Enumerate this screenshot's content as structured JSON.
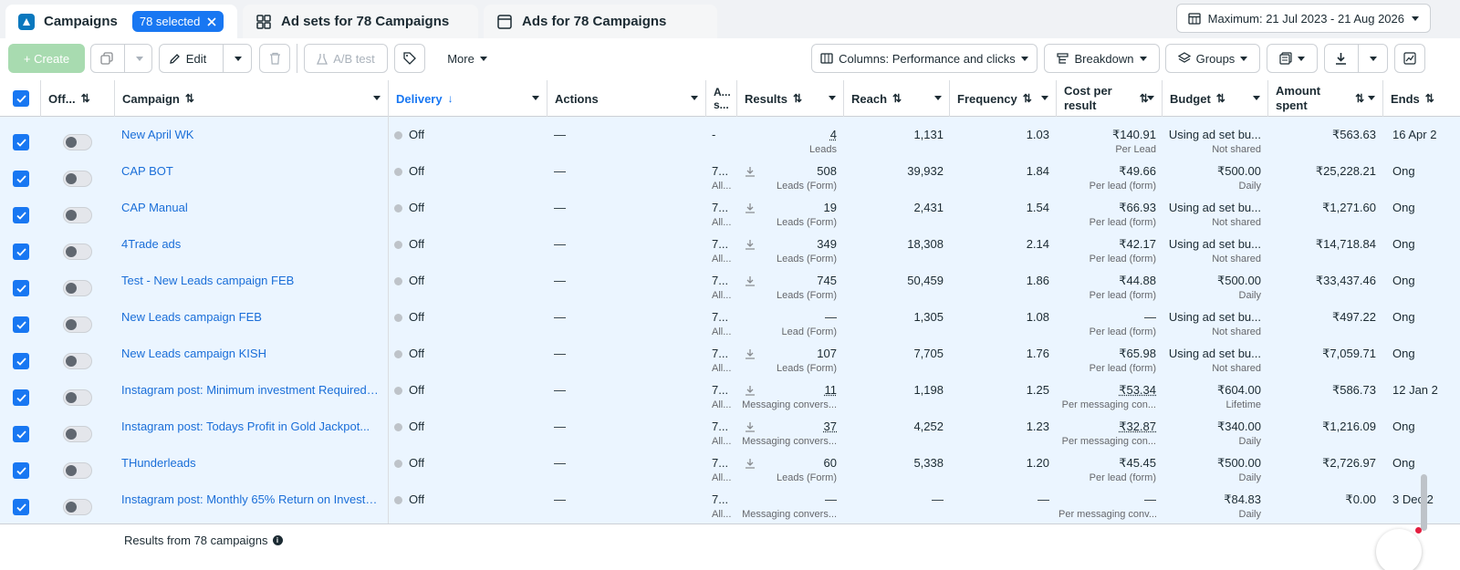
{
  "tabs": {
    "campaigns": "Campaigns",
    "selected_count": "78 selected",
    "ad_sets": "Ad sets for 78 Campaigns",
    "ads": "Ads for 78 Campaigns"
  },
  "date_range": "Maximum: 21 Jul 2023 - 21 Aug 2026",
  "toolbar": {
    "create": "+ Create",
    "edit": "Edit",
    "ab_test": "A/B test",
    "more": "More",
    "columns": "Columns: Performance and clicks",
    "breakdown": "Breakdown",
    "groups": "Groups"
  },
  "headers": {
    "off_on": "Off...",
    "campaign": "Campaign",
    "delivery": "Delivery",
    "actions": "Actions",
    "attribution": "A... s...",
    "results": "Results",
    "reach": "Reach",
    "frequency": "Frequency",
    "cost_per_result_1": "Cost per",
    "cost_per_result_2": "result",
    "budget": "Budget",
    "amount_spent_1": "Amount",
    "amount_spent_2": "spent",
    "ends": "Ends"
  },
  "rows": [
    {
      "name": "New April WK",
      "delivery": "Off",
      "actions": "—",
      "attr": "-",
      "attr_sub": "",
      "results": "4",
      "results_sub": "Leads",
      "reach": "1,131",
      "freq": "1.03",
      "cpr": "₹140.91",
      "cpr_sub": "Per Lead",
      "budget": "Using ad set bu...",
      "budget_sub": "Not shared",
      "spent": "₹563.63",
      "ends": "16 Apr 2"
    },
    {
      "name": "CAP BOT",
      "delivery": "Off",
      "actions": "—",
      "attr": "7...",
      "attr_sub": "All...",
      "results": "508",
      "results_sub": "Leads (Form)",
      "reach": "39,932",
      "freq": "1.84",
      "cpr": "₹49.66",
      "cpr_sub": "Per lead (form)",
      "budget": "₹500.00",
      "budget_sub": "Daily",
      "spent": "₹25,228.21",
      "ends": "Ong"
    },
    {
      "name": "CAP Manual",
      "delivery": "Off",
      "actions": "—",
      "attr": "7...",
      "attr_sub": "All...",
      "results": "19",
      "results_sub": "Leads (Form)",
      "reach": "2,431",
      "freq": "1.54",
      "cpr": "₹66.93",
      "cpr_sub": "Per lead (form)",
      "budget": "Using ad set bu...",
      "budget_sub": "Not shared",
      "spent": "₹1,271.60",
      "ends": "Ong"
    },
    {
      "name": "4Trade ads",
      "delivery": "Off",
      "actions": "—",
      "attr": "7...",
      "attr_sub": "All...",
      "results": "349",
      "results_sub": "Leads (Form)",
      "reach": "18,308",
      "freq": "2.14",
      "cpr": "₹42.17",
      "cpr_sub": "Per lead (form)",
      "budget": "Using ad set bu...",
      "budget_sub": "Not shared",
      "spent": "₹14,718.84",
      "ends": "Ong"
    },
    {
      "name": "Test - New Leads campaign FEB",
      "delivery": "Off",
      "actions": "—",
      "attr": "7...",
      "attr_sub": "All...",
      "results": "745",
      "results_sub": "Leads (Form)",
      "reach": "50,459",
      "freq": "1.86",
      "cpr": "₹44.88",
      "cpr_sub": "Per lead (form)",
      "budget": "₹500.00",
      "budget_sub": "Daily",
      "spent": "₹33,437.46",
      "ends": "Ong"
    },
    {
      "name": "New Leads campaign FEB",
      "delivery": "Off",
      "actions": "—",
      "attr": "7...",
      "attr_sub": "All...",
      "results": "—",
      "results_sub": "Lead (Form)",
      "reach": "1,305",
      "freq": "1.08",
      "cpr": "—",
      "cpr_sub": "Per lead (form)",
      "budget": "Using ad set bu...",
      "budget_sub": "Not shared",
      "spent": "₹497.22",
      "ends": "Ong"
    },
    {
      "name": "New Leads campaign KISH",
      "delivery": "Off",
      "actions": "—",
      "attr": "7...",
      "attr_sub": "All...",
      "results": "107",
      "results_sub": "Leads (Form)",
      "reach": "7,705",
      "freq": "1.76",
      "cpr": "₹65.98",
      "cpr_sub": "Per lead (form)",
      "budget": "Using ad set bu...",
      "budget_sub": "Not shared",
      "spent": "₹7,059.71",
      "ends": "Ong"
    },
    {
      "name": "Instagram post: Minimum investment Required $...",
      "delivery": "Off",
      "actions": "—",
      "attr": "7...",
      "attr_sub": "All...",
      "results": "11",
      "results_sub": "Messaging convers...",
      "reach": "1,198",
      "freq": "1.25",
      "cpr": "₹53.34",
      "cpr_sub": "Per messaging con...",
      "budget": "₹604.00",
      "budget_sub": "Lifetime",
      "spent": "₹586.73",
      "ends": "12 Jan 2"
    },
    {
      "name": "Instagram post: Todays Profit in Gold Jackpot...",
      "delivery": "Off",
      "actions": "—",
      "attr": "7...",
      "attr_sub": "All...",
      "results": "37",
      "results_sub": "Messaging convers...",
      "reach": "4,252",
      "freq": "1.23",
      "cpr": "₹32.87",
      "cpr_sub": "Per messaging con...",
      "budget": "₹340.00",
      "budget_sub": "Daily",
      "spent": "₹1,216.09",
      "ends": "Ong"
    },
    {
      "name": "THunderleads",
      "delivery": "Off",
      "actions": "—",
      "attr": "7...",
      "attr_sub": "All...",
      "results": "60",
      "results_sub": "Leads (Form)",
      "reach": "5,338",
      "freq": "1.20",
      "cpr": "₹45.45",
      "cpr_sub": "Per lead (form)",
      "budget": "₹500.00",
      "budget_sub": "Daily",
      "spent": "₹2,726.97",
      "ends": "Ong"
    },
    {
      "name": "Instagram post: Monthly 65% Return on Investm...",
      "delivery": "Off",
      "actions": "—",
      "attr": "7...",
      "attr_sub": "All...",
      "results": "—",
      "results_sub": "Messaging convers...",
      "reach": "—",
      "freq": "—",
      "cpr": "—",
      "cpr_sub": "Per messaging conv...",
      "budget": "₹84.83",
      "budget_sub": "Daily",
      "spent": "₹0.00",
      "ends": "3 Dec 2"
    }
  ],
  "footer": "Results from 78 campaigns"
}
